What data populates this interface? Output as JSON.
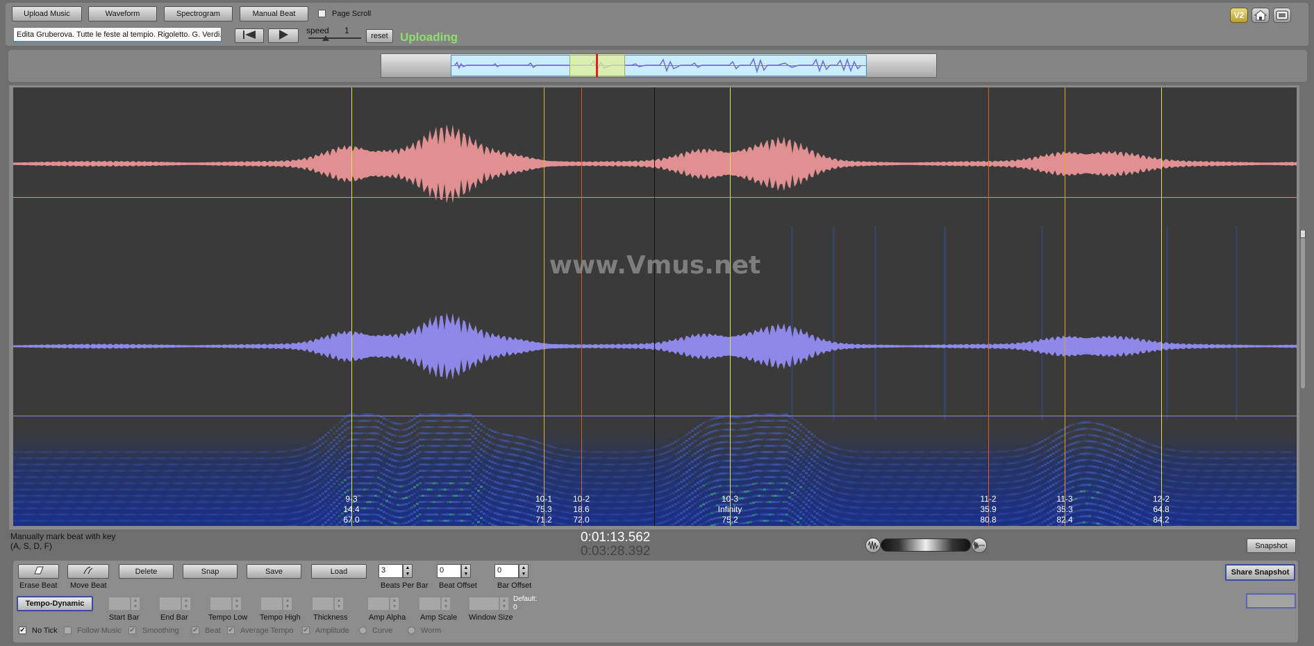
{
  "toolbar": {
    "upload_label": "Upload Music",
    "waveform_label": "Waveform",
    "spectrogram_label": "Spectrogram",
    "manual_beat_label": "Manual Beat",
    "page_scroll_label": "Page Scroll",
    "track_title": "Edita Gruberova. Tutte le feste al tempio. Rigoletto. G. Verdi.",
    "speed_label": "speed",
    "speed_value": "1",
    "reset_label": "reset",
    "status_text": "Uploading",
    "v2_badge": "V2"
  },
  "viewer": {
    "watermark": "www.Vmus.net",
    "beats": [
      {
        "id": "9-3",
        "tempo": "14.4",
        "value": "67.0",
        "color": "#e6e040",
        "pos": 0.2635
      },
      {
        "id": "10-1",
        "tempo": "75.3",
        "value": "71.2",
        "color": "#e8b030",
        "pos": 0.4135
      },
      {
        "id": "10-2",
        "tempo": "18.6",
        "value": "72.0",
        "color": "#e05a20",
        "pos": 0.4425
      },
      {
        "id": "10-3",
        "tempo": "Infinity",
        "value": "75.2",
        "color": "#e6e040",
        "pos": 0.5585
      },
      {
        "id": "11-2",
        "tempo": "35.9",
        "value": "80.8",
        "color": "#e05a20",
        "pos": 0.7595
      },
      {
        "id": "11-3",
        "tempo": "35.3",
        "value": "82.4",
        "color": "#e8a030",
        "pos": 0.8195
      },
      {
        "id": "12-2",
        "tempo": "64.8",
        "value": "84.2",
        "color": "#e6e040",
        "pos": 0.8945
      }
    ],
    "cursor_pos": 0.4995
  },
  "status": {
    "hint_line1": "Manually mark beat with key",
    "hint_line2": "(A, S, D, F)",
    "current_time": "0:01:13.562",
    "total_time": "0:03:28.392",
    "snapshot_label": "Snapshot"
  },
  "bottom": {
    "erase_beat_label": "Erase Beat",
    "move_beat_label": "Move Beat",
    "delete_label": "Delete",
    "snap_label": "Snap",
    "save_label": "Save",
    "load_label": "Load",
    "beats_per_bar_value": "3",
    "beats_per_bar_label": "Beats Per Bar",
    "beat_offset_value": "0",
    "beat_offset_label": "Beat Offset",
    "bar_offset_value": "0",
    "bar_offset_label": "Bar Offset",
    "share_snapshot_label": "Share Snapshot",
    "tempo_dynamic_label": "Tempo-Dynamic",
    "start_bar_label": "Start Bar",
    "end_bar_label": "End Bar",
    "tempo_low_label": "Tempo Low",
    "tempo_high_label": "Tempo High",
    "thickness_label": "Thickness",
    "amp_alpha_label": "Amp Alpha",
    "amp_scale_label": "Amp Scale",
    "window_size_label": "Window Size",
    "default_label": "Default:",
    "default_value": "0",
    "no_tick_label": "No Tick",
    "follow_music_label": "Follow Music",
    "smoothing_label": "Smoothing",
    "beat_label": "Beat",
    "average_tempo_label": "Average Tempo",
    "amplitude_label": "Amplitude",
    "curve_label": "Curve",
    "worm_label": "Worm"
  }
}
